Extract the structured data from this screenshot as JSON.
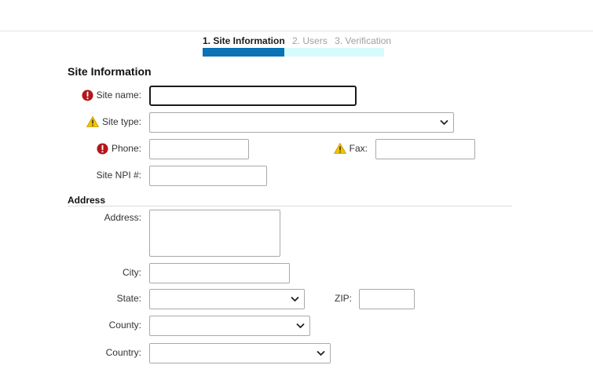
{
  "wizard": {
    "steps": [
      {
        "label": "1. Site Information",
        "active": true
      },
      {
        "label": "2. Users",
        "active": false
      },
      {
        "label": "3. Verification",
        "active": false
      }
    ],
    "progress": 0.45,
    "colors": {
      "accent": "#0a72b5",
      "track": "#d6fbfd"
    }
  },
  "site_info": {
    "title": "Site Information",
    "site_name": {
      "label": "Site name:",
      "value": "",
      "status": "error"
    },
    "site_type": {
      "label": "Site type:",
      "value": "",
      "status": "warning"
    },
    "phone": {
      "label": "Phone:",
      "value": "",
      "status": "error"
    },
    "fax": {
      "label": "Fax:",
      "value": "",
      "status": "warning"
    },
    "npi": {
      "label": "Site NPI #:",
      "value": ""
    }
  },
  "address": {
    "title": "Address",
    "address": {
      "label": "Address:",
      "value": ""
    },
    "city": {
      "label": "City:",
      "value": ""
    },
    "state": {
      "label": "State:",
      "value": ""
    },
    "zip": {
      "label": "ZIP:",
      "value": ""
    },
    "county": {
      "label": "County:",
      "value": ""
    },
    "country": {
      "label": "Country:",
      "value": ""
    }
  },
  "icons": {
    "error": "error-icon",
    "warning": "warning-icon",
    "dropdown": "chevron-down-icon"
  },
  "status_colors": {
    "error": "#b3161b",
    "warning": "#f2c200"
  }
}
